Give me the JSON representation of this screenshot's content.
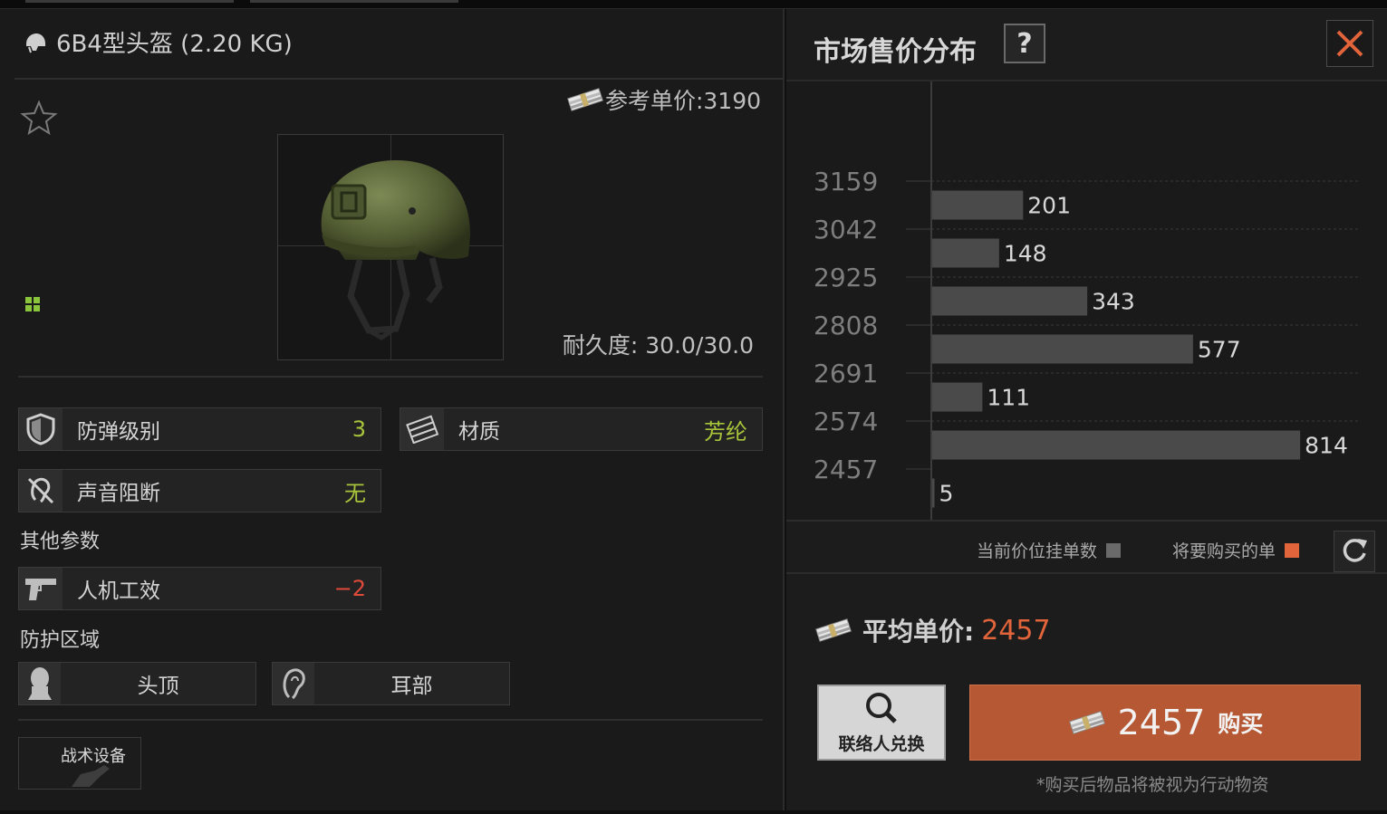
{
  "item": {
    "title": "6B4型头盔 (2.20 KG)",
    "ref_price_label": "参考单价:3190",
    "durability": "耐久度: 30.0/30.0"
  },
  "stats": {
    "armor_class": {
      "label": "防弹级别",
      "value": "3",
      "icon": "shield-icon"
    },
    "material": {
      "label": "材质",
      "value": "芳纶",
      "icon": "material-icon"
    },
    "sound_block": {
      "label": "声音阻断",
      "value": "无",
      "icon": "muted-ear-icon"
    },
    "ergonomics": {
      "label": "人机工效",
      "value": "−2",
      "icon": "pistol-icon"
    }
  },
  "sections": {
    "other_params": "其他参数",
    "protect_zones": "防护区域"
  },
  "zones": [
    {
      "label": "头顶",
      "icon": "head-icon"
    },
    {
      "label": "耳部",
      "icon": "ear-icon"
    }
  ],
  "tactical_slot": {
    "label": "战术设备"
  },
  "market": {
    "title": "市场售价分布",
    "help": "?",
    "legend_current": "当前价位挂单数",
    "legend_buy": "将要购买的单",
    "avg_label": "平均单价:",
    "avg_value": "2457",
    "contact_label": "联络人兑换",
    "buy_price": "2457",
    "buy_label": "购买",
    "footnote": "*购买后物品将被视为行动物资"
  },
  "colors": {
    "accent_orange": "#e2643a",
    "buy_button": "#b65833",
    "bar": "#4a4a4a",
    "legend_current": "#6a6a6a",
    "legend_buy": "#e2643a",
    "positive_green": "#a8c43a",
    "negative_red": "#e04a3a"
  },
  "chart_data": {
    "type": "bar",
    "orientation": "horizontal",
    "y_tick_labels": [
      "3159",
      "3042",
      "2925",
      "2808",
      "2691",
      "2574",
      "2457"
    ],
    "bars": [
      {
        "price_bucket": "3159",
        "count": 201
      },
      {
        "price_bucket": "3042",
        "count": 148
      },
      {
        "price_bucket": "2925",
        "count": 343
      },
      {
        "price_bucket": "2808",
        "count": 577
      },
      {
        "price_bucket": "2691",
        "count": 111
      },
      {
        "price_bucket": "2574",
        "count": 814
      },
      {
        "price_bucket": "2457",
        "count": 5
      }
    ],
    "xlim": [
      0,
      950
    ],
    "grid": true,
    "title": "",
    "xlabel": "",
    "ylabel": ""
  }
}
